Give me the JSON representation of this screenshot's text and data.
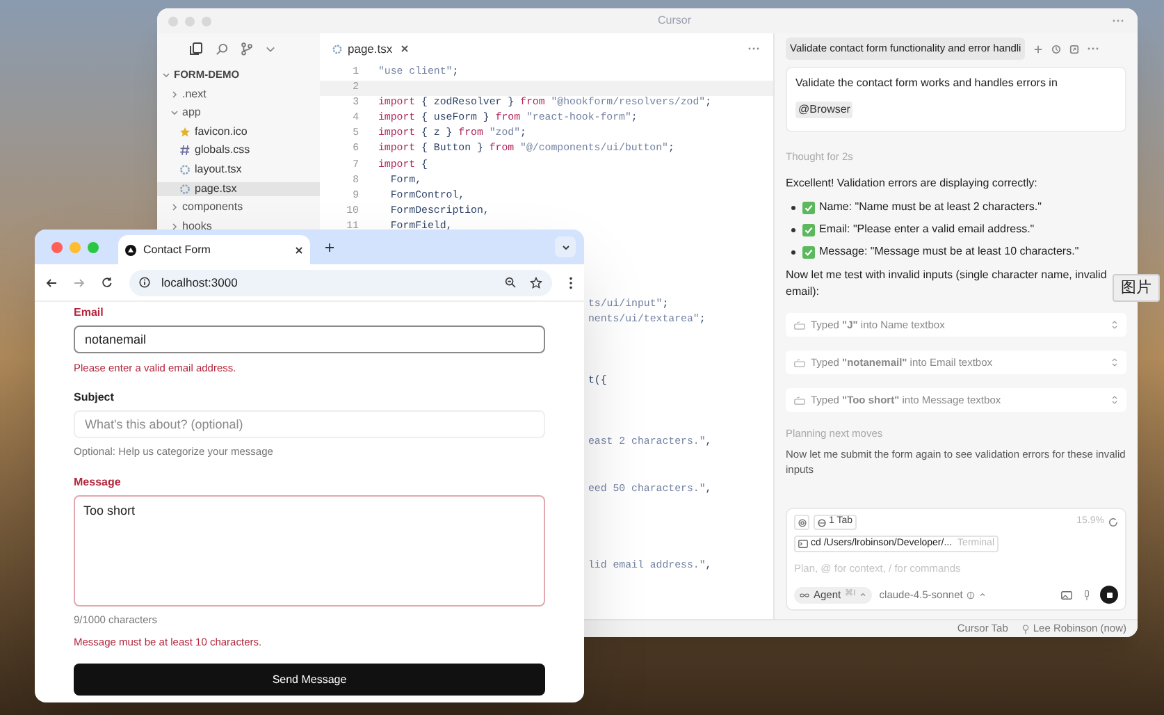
{
  "editor_window": {
    "title": "Cursor",
    "tree": [
      {
        "label": "FORM-DEMO",
        "kind": "root",
        "expanded": true,
        "selected": false,
        "children": [
          {
            "label": ".next",
            "kind": "folder",
            "expanded": false,
            "selected": false
          },
          {
            "label": "app",
            "kind": "folder",
            "expanded": true,
            "selected": false,
            "children": [
              {
                "label": "favicon.ico",
                "kind": "ico",
                "selected": false
              },
              {
                "label": "globals.css",
                "kind": "css",
                "selected": false
              },
              {
                "label": "layout.tsx",
                "kind": "tsx",
                "selected": false
              },
              {
                "label": "page.tsx",
                "kind": "tsx",
                "selected": true
              }
            ]
          },
          {
            "label": "components",
            "kind": "folder",
            "expanded": false,
            "selected": false
          },
          {
            "label": "hooks",
            "kind": "folder",
            "expanded": false,
            "selected": false
          }
        ]
      }
    ],
    "editor_tab": "page.tsx",
    "code_lines": [
      {
        "number": "1",
        "current": false,
        "tokens": [
          {
            "text": "\"use client\"",
            "kind": "string"
          },
          {
            "text": ";",
            "kind": "plain"
          }
        ]
      },
      {
        "number": "2",
        "current": true
      },
      {
        "number": "3",
        "current": false,
        "tokens": [
          {
            "text": "import",
            "kind": "keyword"
          },
          {
            "text": " { zodResolver } ",
            "kind": "plain"
          },
          {
            "text": "from",
            "kind": "keyword"
          },
          {
            "text": " \"@hookform/resolvers/zod\"",
            "kind": "string"
          },
          {
            "text": ";",
            "kind": "plain"
          }
        ]
      },
      {
        "number": "4",
        "current": false,
        "tokens": [
          {
            "text": "import",
            "kind": "keyword"
          },
          {
            "text": " { useForm } ",
            "kind": "plain"
          },
          {
            "text": "from",
            "kind": "keyword"
          },
          {
            "text": " \"react-hook-form\"",
            "kind": "string"
          },
          {
            "text": ";",
            "kind": "plain"
          }
        ]
      },
      {
        "number": "5",
        "current": false,
        "tokens": [
          {
            "text": "import",
            "kind": "keyword"
          },
          {
            "text": " { z } ",
            "kind": "plain"
          },
          {
            "text": "from",
            "kind": "keyword"
          },
          {
            "text": " \"zod\"",
            "kind": "string"
          },
          {
            "text": ";",
            "kind": "plain"
          }
        ]
      },
      {
        "number": "6",
        "current": false,
        "tokens": [
          {
            "text": "import",
            "kind": "keyword"
          },
          {
            "text": " { Button } ",
            "kind": "plain"
          },
          {
            "text": "from",
            "kind": "keyword"
          },
          {
            "text": " \"@/components/ui/button\"",
            "kind": "string"
          },
          {
            "text": ";",
            "kind": "plain"
          }
        ]
      },
      {
        "number": "7",
        "current": false,
        "tokens": [
          {
            "text": "import",
            "kind": "keyword"
          },
          {
            "text": " {",
            "kind": "plain"
          }
        ]
      },
      {
        "number": "8",
        "current": false,
        "tokens": [
          {
            "text": "  Form,",
            "kind": "plain"
          }
        ]
      },
      {
        "number": "9",
        "current": false,
        "tokens": [
          {
            "text": "  FormControl,",
            "kind": "plain"
          }
        ]
      },
      {
        "number": "10",
        "current": false,
        "tokens": [
          {
            "text": "  FormDescription,",
            "kind": "plain"
          }
        ]
      },
      {
        "number": "11",
        "current": false,
        "tokens": [
          {
            "text": "  FormField,",
            "kind": "plain"
          }
        ]
      }
    ],
    "code_fragments": [
      [
        {
          "text": "ts/ui/input\"",
          "kind": "string"
        },
        {
          "text": ";",
          "kind": "plain"
        }
      ],
      [
        {
          "text": "nents/ui/textarea\"",
          "kind": "string"
        },
        {
          "text": ";",
          "kind": "plain"
        }
      ],
      [
        {
          "text": "t({",
          "kind": "plain"
        }
      ],
      [
        {
          "text": "east 2 characters.\"",
          "kind": "string"
        },
        {
          "text": ",",
          "kind": "plain"
        }
      ],
      [
        {
          "text": "eed 50 characters.\"",
          "kind": "string"
        },
        {
          "text": ",",
          "kind": "plain"
        }
      ],
      [
        {
          "text": "lid email address.\"",
          "kind": "string"
        },
        {
          "text": ",",
          "kind": "plain"
        }
      ]
    ],
    "chat": {
      "tab_title": "Validate contact form functionality and error handli",
      "user_message": "Validate the contact form works and handles errors in",
      "mention": "@Browser",
      "thought": "Thought for 2s",
      "intro": "Excellent! Validation errors are displaying correctly:",
      "bullets": [
        "Name: \"Name must be at least 2 characters.\"",
        "Email: \"Please enter a valid email address.\"",
        "Message: \"Message must be at least 10 characters.\""
      ],
      "followup": "Now let me test with invalid inputs (single character name, invalid email):",
      "tool_calls": [
        "Typed **\"J\"** into Name textbox",
        "Typed **\"notanemail\"** into Email textbox",
        "Typed **\"Too short\"** into Message textbox"
      ],
      "status": "Planning next moves",
      "note": "Now let me submit the form again to see validation errors for these invalid inputs",
      "composer": {
        "tab_chip": "1 Tab",
        "usage": "15.9%",
        "terminal_chip": "cd /Users/lrobinson/Developer/...",
        "terminal_label": "Terminal",
        "placeholder": "Plan, @ for context, / for commands",
        "mode": "Agent",
        "mode_shortcut": "⌘I",
        "model": "claude-4.5-sonnet"
      }
    },
    "status_bar": {
      "left": "Cursor Tab",
      "user": "Lee Robinson (now)"
    }
  },
  "browser_window": {
    "tab_title": "Contact Form",
    "url": "localhost:3000",
    "fields": [
      {
        "label": "Email",
        "kind": "input",
        "value": "notanemail",
        "focused": true,
        "invalid": true,
        "error": "Please enter a valid email address."
      },
      {
        "label": "Subject",
        "kind": "input",
        "placeholder": "What's this about? (optional)",
        "focused": false,
        "invalid": false,
        "hint": "Optional: Help us categorize your message"
      },
      {
        "label": "Message",
        "kind": "textarea",
        "value": "Too short",
        "focused": false,
        "invalid": true,
        "hint": "9/1000 characters",
        "error": "Message must be at least 10 characters."
      }
    ],
    "submit": "Send Message"
  },
  "tooltip": "图片"
}
